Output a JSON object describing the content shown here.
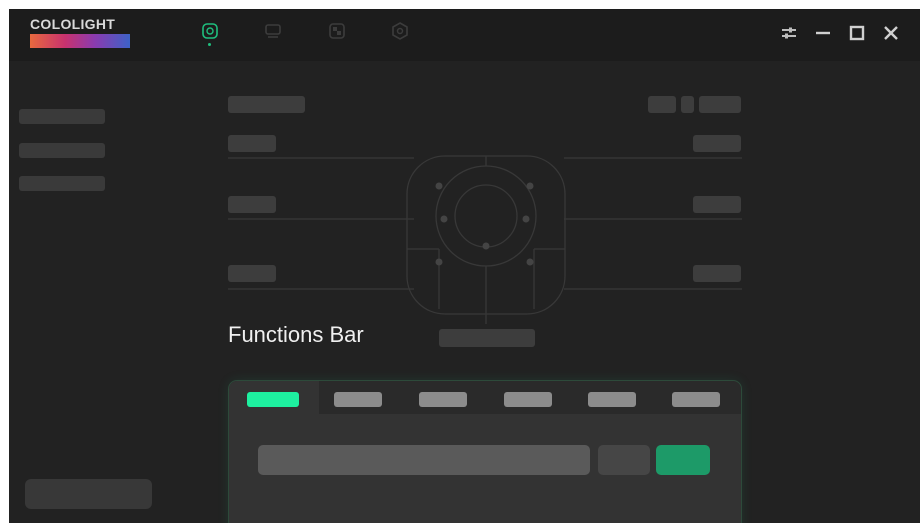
{
  "app": {
    "brand": "COLOLIGHT",
    "brand_gradient": [
      "#e8693e",
      "#c8326e",
      "#8a3bb0",
      "#3d62c7"
    ]
  },
  "top_nav": {
    "items": [
      {
        "icon": "light-controller-icon",
        "active": true
      },
      {
        "icon": "monitor-icon",
        "active": false
      },
      {
        "icon": "gallery-icon",
        "active": false
      },
      {
        "icon": "settings-icon",
        "active": false
      }
    ]
  },
  "window_controls": [
    {
      "icon": "sliders-icon"
    },
    {
      "icon": "minimize-icon"
    },
    {
      "icon": "maximize-icon"
    },
    {
      "icon": "close-icon"
    }
  ],
  "main": {
    "section_title": "Functions Bar"
  },
  "colors": {
    "accent": "#1ef0a0",
    "accent_dark": "#1d9a68",
    "background": "#222222",
    "titlebar": "#1c1c1c"
  }
}
